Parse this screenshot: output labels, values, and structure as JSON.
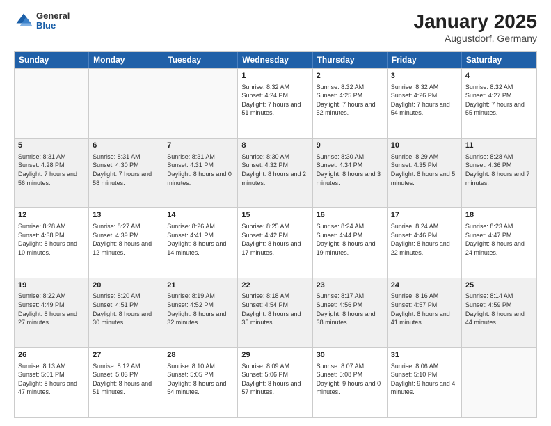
{
  "header": {
    "logo": {
      "general": "General",
      "blue": "Blue"
    },
    "title": "January 2025",
    "location": "Augustdorf, Germany"
  },
  "weekdays": [
    "Sunday",
    "Monday",
    "Tuesday",
    "Wednesday",
    "Thursday",
    "Friday",
    "Saturday"
  ],
  "weeks": [
    [
      {
        "day": "",
        "empty": true
      },
      {
        "day": "",
        "empty": true
      },
      {
        "day": "",
        "empty": true
      },
      {
        "day": "1",
        "sunrise": "8:32 AM",
        "sunset": "4:24 PM",
        "daylight": "7 hours and 51 minutes."
      },
      {
        "day": "2",
        "sunrise": "8:32 AM",
        "sunset": "4:25 PM",
        "daylight": "7 hours and 52 minutes."
      },
      {
        "day": "3",
        "sunrise": "8:32 AM",
        "sunset": "4:26 PM",
        "daylight": "7 hours and 54 minutes."
      },
      {
        "day": "4",
        "sunrise": "8:32 AM",
        "sunset": "4:27 PM",
        "daylight": "7 hours and 55 minutes."
      }
    ],
    [
      {
        "day": "5",
        "sunrise": "8:31 AM",
        "sunset": "4:28 PM",
        "daylight": "7 hours and 56 minutes."
      },
      {
        "day": "6",
        "sunrise": "8:31 AM",
        "sunset": "4:30 PM",
        "daylight": "7 hours and 58 minutes."
      },
      {
        "day": "7",
        "sunrise": "8:31 AM",
        "sunset": "4:31 PM",
        "daylight": "8 hours and 0 minutes."
      },
      {
        "day": "8",
        "sunrise": "8:30 AM",
        "sunset": "4:32 PM",
        "daylight": "8 hours and 2 minutes."
      },
      {
        "day": "9",
        "sunrise": "8:30 AM",
        "sunset": "4:34 PM",
        "daylight": "8 hours and 3 minutes."
      },
      {
        "day": "10",
        "sunrise": "8:29 AM",
        "sunset": "4:35 PM",
        "daylight": "8 hours and 5 minutes."
      },
      {
        "day": "11",
        "sunrise": "8:28 AM",
        "sunset": "4:36 PM",
        "daylight": "8 hours and 7 minutes."
      }
    ],
    [
      {
        "day": "12",
        "sunrise": "8:28 AM",
        "sunset": "4:38 PM",
        "daylight": "8 hours and 10 minutes."
      },
      {
        "day": "13",
        "sunrise": "8:27 AM",
        "sunset": "4:39 PM",
        "daylight": "8 hours and 12 minutes."
      },
      {
        "day": "14",
        "sunrise": "8:26 AM",
        "sunset": "4:41 PM",
        "daylight": "8 hours and 14 minutes."
      },
      {
        "day": "15",
        "sunrise": "8:25 AM",
        "sunset": "4:42 PM",
        "daylight": "8 hours and 17 minutes."
      },
      {
        "day": "16",
        "sunrise": "8:24 AM",
        "sunset": "4:44 PM",
        "daylight": "8 hours and 19 minutes."
      },
      {
        "day": "17",
        "sunrise": "8:24 AM",
        "sunset": "4:46 PM",
        "daylight": "8 hours and 22 minutes."
      },
      {
        "day": "18",
        "sunrise": "8:23 AM",
        "sunset": "4:47 PM",
        "daylight": "8 hours and 24 minutes."
      }
    ],
    [
      {
        "day": "19",
        "sunrise": "8:22 AM",
        "sunset": "4:49 PM",
        "daylight": "8 hours and 27 minutes."
      },
      {
        "day": "20",
        "sunrise": "8:20 AM",
        "sunset": "4:51 PM",
        "daylight": "8 hours and 30 minutes."
      },
      {
        "day": "21",
        "sunrise": "8:19 AM",
        "sunset": "4:52 PM",
        "daylight": "8 hours and 32 minutes."
      },
      {
        "day": "22",
        "sunrise": "8:18 AM",
        "sunset": "4:54 PM",
        "daylight": "8 hours and 35 minutes."
      },
      {
        "day": "23",
        "sunrise": "8:17 AM",
        "sunset": "4:56 PM",
        "daylight": "8 hours and 38 minutes."
      },
      {
        "day": "24",
        "sunrise": "8:16 AM",
        "sunset": "4:57 PM",
        "daylight": "8 hours and 41 minutes."
      },
      {
        "day": "25",
        "sunrise": "8:14 AM",
        "sunset": "4:59 PM",
        "daylight": "8 hours and 44 minutes."
      }
    ],
    [
      {
        "day": "26",
        "sunrise": "8:13 AM",
        "sunset": "5:01 PM",
        "daylight": "8 hours and 47 minutes."
      },
      {
        "day": "27",
        "sunrise": "8:12 AM",
        "sunset": "5:03 PM",
        "daylight": "8 hours and 51 minutes."
      },
      {
        "day": "28",
        "sunrise": "8:10 AM",
        "sunset": "5:05 PM",
        "daylight": "8 hours and 54 minutes."
      },
      {
        "day": "29",
        "sunrise": "8:09 AM",
        "sunset": "5:06 PM",
        "daylight": "8 hours and 57 minutes."
      },
      {
        "day": "30",
        "sunrise": "8:07 AM",
        "sunset": "5:08 PM",
        "daylight": "9 hours and 0 minutes."
      },
      {
        "day": "31",
        "sunrise": "8:06 AM",
        "sunset": "5:10 PM",
        "daylight": "9 hours and 4 minutes."
      },
      {
        "day": "",
        "empty": true
      }
    ]
  ]
}
